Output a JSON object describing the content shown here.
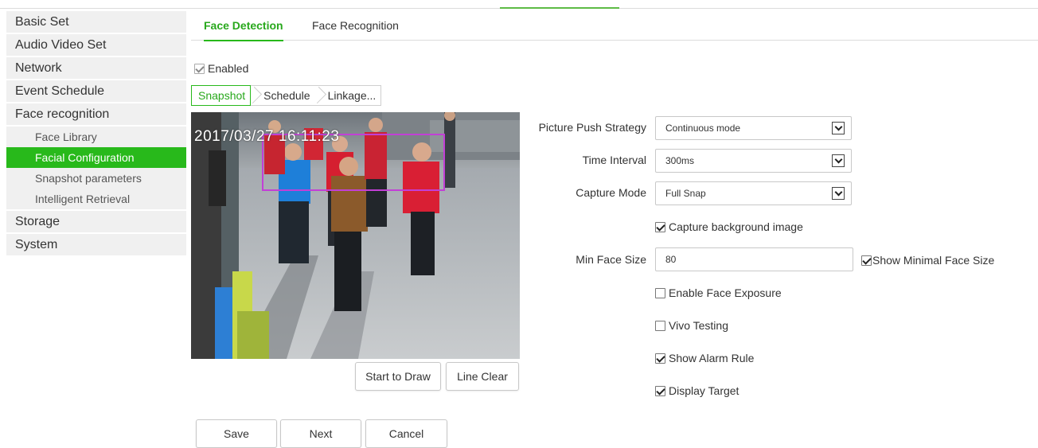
{
  "sidebar": {
    "items": [
      {
        "label": "Basic Set"
      },
      {
        "label": "Audio Video Set"
      },
      {
        "label": "Network"
      },
      {
        "label": "Event Schedule"
      },
      {
        "label": "Face recognition",
        "children": [
          {
            "label": "Face Library"
          },
          {
            "label": "Facial Configuration",
            "active": true
          },
          {
            "label": "Snapshot parameters"
          },
          {
            "label": "Intelligent Retrieval"
          }
        ]
      },
      {
        "label": "Storage"
      },
      {
        "label": "System"
      }
    ]
  },
  "tabs": [
    {
      "label": "Face Detection",
      "active": true
    },
    {
      "label": "Face Recognition"
    }
  ],
  "enabled": {
    "label": "Enabled",
    "checked": true
  },
  "steps": [
    {
      "label": "Snapshot",
      "active": true
    },
    {
      "label": "Schedule"
    },
    {
      "label": "Linkage..."
    }
  ],
  "video": {
    "timestamp": "2017/03/27 16:11:23"
  },
  "draw_buttons": {
    "start": "Start to Draw",
    "clear": "Line Clear"
  },
  "form": {
    "picture_push_strategy": {
      "label": "Picture Push Strategy",
      "value": "Continuous mode"
    },
    "time_interval": {
      "label": "Time Interval",
      "value": "300ms"
    },
    "capture_mode": {
      "label": "Capture Mode",
      "value": "Full Snap"
    },
    "capture_background": {
      "label": "Capture background image",
      "checked": true
    },
    "min_face_size": {
      "label": "Min Face Size",
      "value": "80"
    },
    "show_minimal_face_size": {
      "label": "Show Minimal Face Size",
      "checked": true
    },
    "enable_face_exposure": {
      "label": "Enable Face Exposure",
      "checked": false
    },
    "vivo_testing": {
      "label": "Vivo Testing",
      "checked": false
    },
    "show_alarm_rule": {
      "label": "Show Alarm Rule",
      "checked": true
    },
    "display_target": {
      "label": "Display Target",
      "checked": true
    }
  },
  "footer": {
    "save": "Save",
    "next": "Next",
    "cancel": "Cancel"
  },
  "colors": {
    "accent": "#28b91b",
    "face_box": "#c23fd6"
  }
}
